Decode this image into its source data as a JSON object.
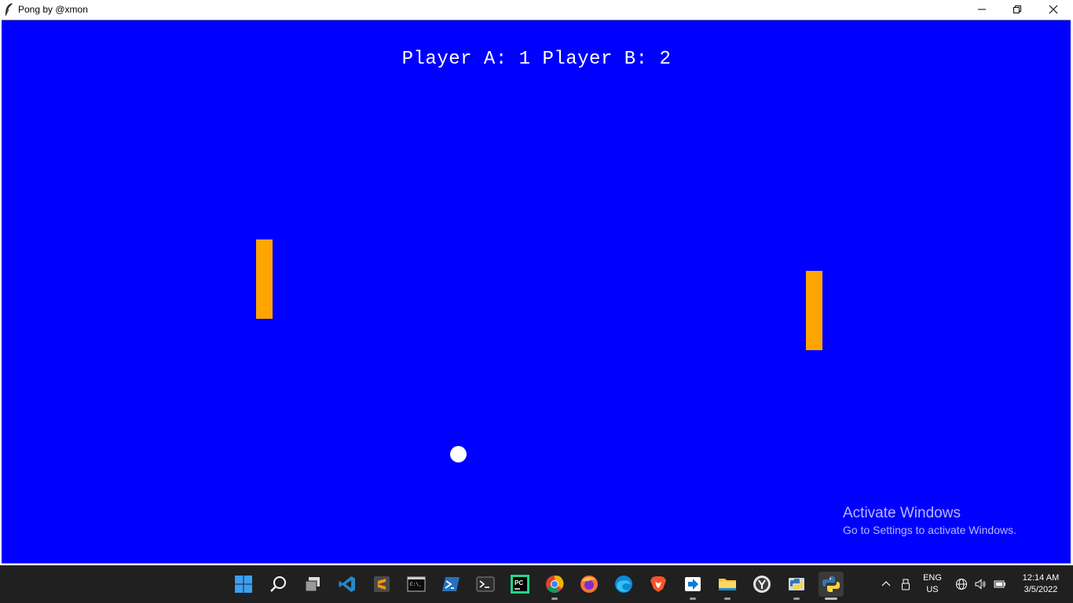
{
  "window": {
    "title": "Pong by @xmon",
    "icon": "feather-icon"
  },
  "game": {
    "score_text": "Player A: 1 Player B: 2",
    "colors": {
      "background": "#0000ff",
      "paddle": "#ffa500",
      "ball": "#ffffff",
      "text": "#ffffff"
    }
  },
  "watermark": {
    "title": "Activate Windows",
    "subtitle": "Go to Settings to activate Windows."
  },
  "taskbar": {
    "apps": [
      {
        "name": "start-button",
        "icon": "windows-logo-icon"
      },
      {
        "name": "search-button",
        "icon": "search-icon"
      },
      {
        "name": "task-view-button",
        "icon": "task-view-icon"
      },
      {
        "name": "vscode-app",
        "icon": "vscode-icon"
      },
      {
        "name": "sublime-text-app",
        "icon": "sublime-text-icon"
      },
      {
        "name": "command-prompt-app",
        "icon": "cmd-icon"
      },
      {
        "name": "powershell-app",
        "icon": "powershell-icon"
      },
      {
        "name": "terminal-app",
        "icon": "terminal-icon"
      },
      {
        "name": "pycharm-app",
        "icon": "pycharm-icon"
      },
      {
        "name": "chrome-app",
        "icon": "chrome-icon"
      },
      {
        "name": "firefox-app",
        "icon": "firefox-icon"
      },
      {
        "name": "edge-app",
        "icon": "edge-icon"
      },
      {
        "name": "brave-app",
        "icon": "brave-icon"
      },
      {
        "name": "remote-app",
        "icon": "remote-icon"
      },
      {
        "name": "file-explorer-app",
        "icon": "folder-icon"
      },
      {
        "name": "yandex-app",
        "icon": "yandex-icon"
      },
      {
        "name": "python-idle-app",
        "icon": "python-idle-icon"
      },
      {
        "name": "python-app",
        "icon": "python-icon"
      }
    ],
    "tray": {
      "lang_line1": "ENG",
      "lang_line2": "US",
      "time": "12:14 AM",
      "date": "3/5/2022"
    }
  }
}
